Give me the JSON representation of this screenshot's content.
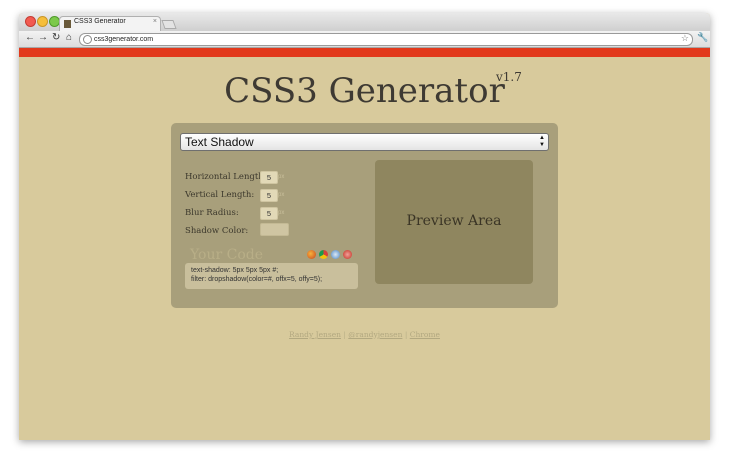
{
  "browser": {
    "tab_title": "CSS3 Generator",
    "tab_close": "×",
    "url": "css3generator.com",
    "nav": {
      "back": "←",
      "forward": "→",
      "reload": "↻",
      "home": "⌂",
      "star": "☆",
      "wrench": "🔧"
    }
  },
  "page": {
    "title": "CSS3 Generator",
    "version": "v1.7"
  },
  "form": {
    "selected_option": "Text Shadow",
    "select_arrows": "▲▼",
    "fields": [
      {
        "label": "Horizontal Length:",
        "value": "5",
        "unit": "px"
      },
      {
        "label": "Vertical Length:",
        "value": "5",
        "unit": "px"
      },
      {
        "label": "Blur Radius:",
        "value": "5",
        "unit": "px"
      }
    ],
    "shadow_color_label": "Shadow Color:"
  },
  "preview": {
    "label": "Preview Area"
  },
  "code": {
    "heading": "Your Code",
    "browsers": [
      "firefox-icon",
      "chrome-icon",
      "safari-icon",
      "opera-icon"
    ],
    "line1": "text-shadow: 5px 5px 5px #;",
    "line2": "filter: dropshadow(color=#, offx=5, offy=5);"
  },
  "footer": {
    "link1": "Randy Jensen",
    "sep": "|",
    "link2": "@randyjensen",
    "link3": "Chrome"
  },
  "colors": {
    "page_bg": "#d8ca9c",
    "accent_bar": "#e2391b",
    "panel": "#a89f7b",
    "preview": "#8f865f"
  }
}
